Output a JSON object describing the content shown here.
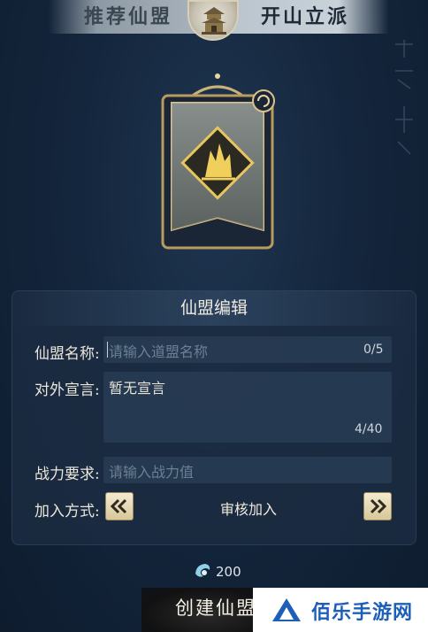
{
  "tabs": {
    "left_label": "推荐仙盟",
    "right_label": "开山立派"
  },
  "panel": {
    "title": "仙盟编辑",
    "name_label": "仙盟名称:",
    "name_placeholder": "请输入道盟名称",
    "name_counter": "0/5",
    "declaration_label": "对外宣言:",
    "declaration_value": "暂无宣言",
    "declaration_counter": "4/40",
    "power_label": "战力要求:",
    "power_placeholder": "请输入战力值",
    "join_label": "加入方式:",
    "join_value": "审核加入"
  },
  "cost": {
    "amount": "200",
    "icon": "spirit-stone-icon"
  },
  "create_button_label": "创建仙盟",
  "watermark": {
    "text": "佰乐手游网",
    "icon": "triangle-logo-icon"
  },
  "colors": {
    "background": "#14263d",
    "panel": "#1c2d42",
    "gold": "#d8c79a",
    "watermark_blue": "#1d5fb8"
  }
}
